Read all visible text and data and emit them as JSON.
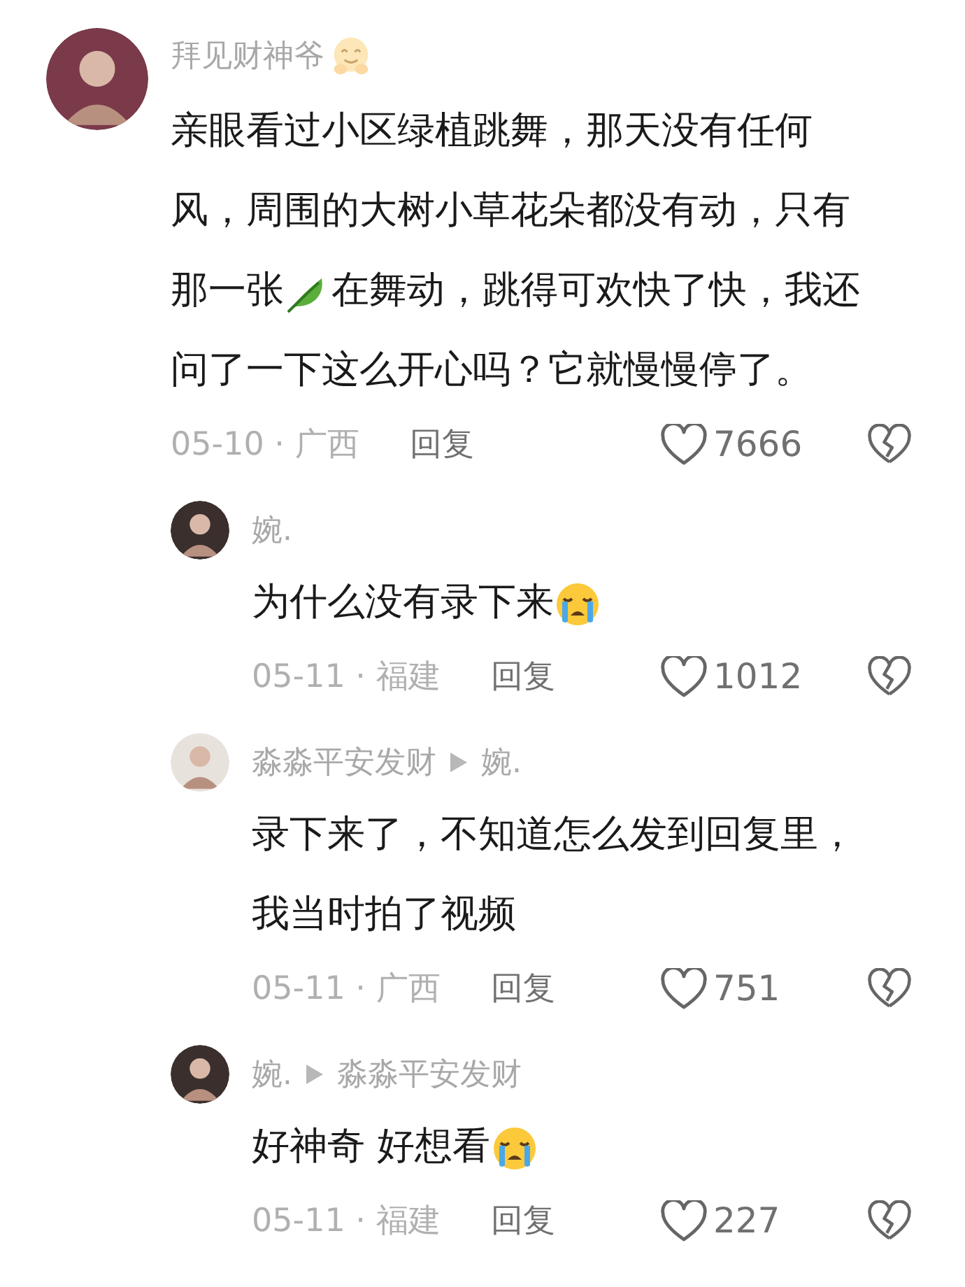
{
  "comments": [
    {
      "kind": "comment",
      "author": [
        {
          "kind": "text",
          "text": "拜见财神爷"
        },
        {
          "kind": "hugging"
        }
      ],
      "lines": [
        [
          {
            "kind": "text",
            "text": "亲眼看过小区绿植跳舞，那天没有任何"
          }
        ],
        [
          {
            "kind": "text",
            "text": "风，周围的大树小草花朵都没有动，只有"
          }
        ],
        [
          {
            "kind": "text",
            "text": "那一张"
          },
          {
            "kind": "leaf"
          },
          {
            "kind": "text",
            "text": "在舞动，跳得可欢快了快，我还"
          }
        ],
        [
          {
            "kind": "text",
            "text": "问了一下这么开心吗？它就慢慢停了。"
          }
        ]
      ],
      "date": "05-10 · 广西",
      "reply": "回复",
      "likes": "7666"
    },
    {
      "kind": "reply",
      "author": [
        {
          "kind": "text",
          "text": "婉."
        }
      ],
      "lines": [
        [
          {
            "kind": "text",
            "text": "为什么没有录下来"
          },
          {
            "kind": "crying"
          }
        ]
      ],
      "date": "05-11 · 福建",
      "reply": "回复",
      "likes": "1012"
    },
    {
      "kind": "reply",
      "author": [
        {
          "kind": "text",
          "text": "淼淼平安发财"
        }
      ],
      "reply_to": "婉.",
      "lines": [
        [
          {
            "kind": "text",
            "text": "录下来了，不知道怎么发到回复里，"
          }
        ],
        [
          {
            "kind": "text",
            "text": "我当时拍了视频"
          }
        ]
      ],
      "date": "05-11 · 广西",
      "reply": "回复",
      "likes": "751"
    },
    {
      "kind": "reply",
      "author": [
        {
          "kind": "text",
          "text": "婉."
        }
      ],
      "reply_to": "淼淼平安发财",
      "lines": [
        [
          {
            "kind": "text",
            "text": "好神奇 好想看"
          },
          {
            "kind": "crying"
          }
        ]
      ],
      "date": "05-11 · 福建",
      "reply": "回复",
      "likes": "227"
    }
  ]
}
